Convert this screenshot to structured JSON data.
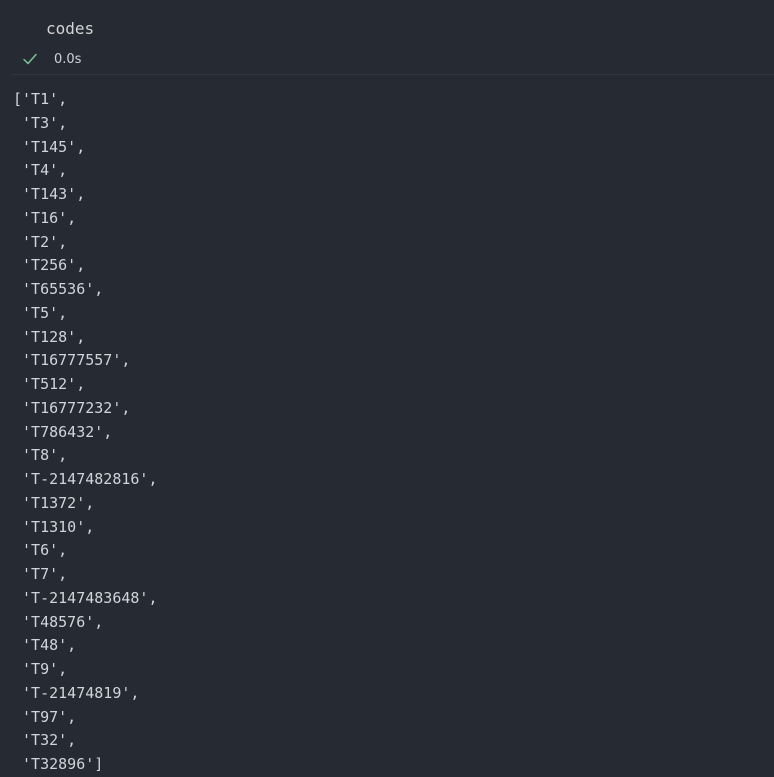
{
  "cell": {
    "code": "codes",
    "status_icon": "check-icon",
    "status_color": "#73c991",
    "exec_time": "0.0s"
  },
  "output": {
    "lines": [
      "['T1',",
      " 'T3',",
      " 'T145',",
      " 'T4',",
      " 'T143',",
      " 'T16',",
      " 'T2',",
      " 'T256',",
      " 'T65536',",
      " 'T5',",
      " 'T128',",
      " 'T16777557',",
      " 'T512',",
      " 'T16777232',",
      " 'T786432',",
      " 'T8',",
      " 'T-2147482816',",
      " 'T1372',",
      " 'T1310',",
      " 'T6',",
      " 'T7',",
      " 'T-2147483648',",
      " 'T48576',",
      " 'T48',",
      " 'T9',",
      " 'T-21474819',",
      " 'T97',",
      " 'T32',",
      " 'T32896']"
    ]
  }
}
